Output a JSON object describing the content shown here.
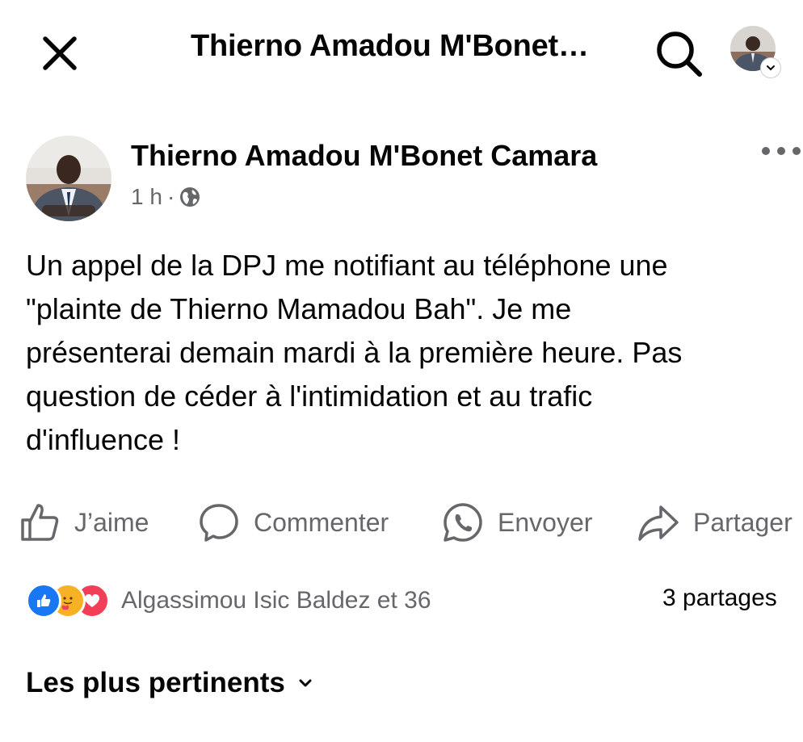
{
  "header": {
    "title": "Thierno Amadou M'Bonet…"
  },
  "post": {
    "author": "Thierno Amadou M'Bonet Camara",
    "time": "1 h",
    "separator": "·",
    "audience_icon": "globe-icon",
    "text_lines": [
      "Un appel de la DPJ me notifiant au téléphone une",
      "\"plainte de Thierno Mamadou Bah\". Je me",
      "présenterai demain mardi à la première heure. Pas",
      "question de céder à l'intimidation et au trafic",
      "d'influence  !"
    ]
  },
  "actions": {
    "like": "J’aime",
    "comment": "Commenter",
    "send": "Envoyer",
    "share": "Partager"
  },
  "reactions": {
    "icons": [
      "like-reaction-icon",
      "care-reaction-icon",
      "love-reaction-icon"
    ],
    "names": "Algassimou Isic Baldez et 36",
    "shares": "3 partages"
  },
  "sort": {
    "label": "Les plus pertinents"
  },
  "colors": {
    "text": "#050505",
    "secondary": "#65676b",
    "like_blue": "#1877f2",
    "love_red": "#f33e58",
    "care_yellow": "#f7b125"
  }
}
